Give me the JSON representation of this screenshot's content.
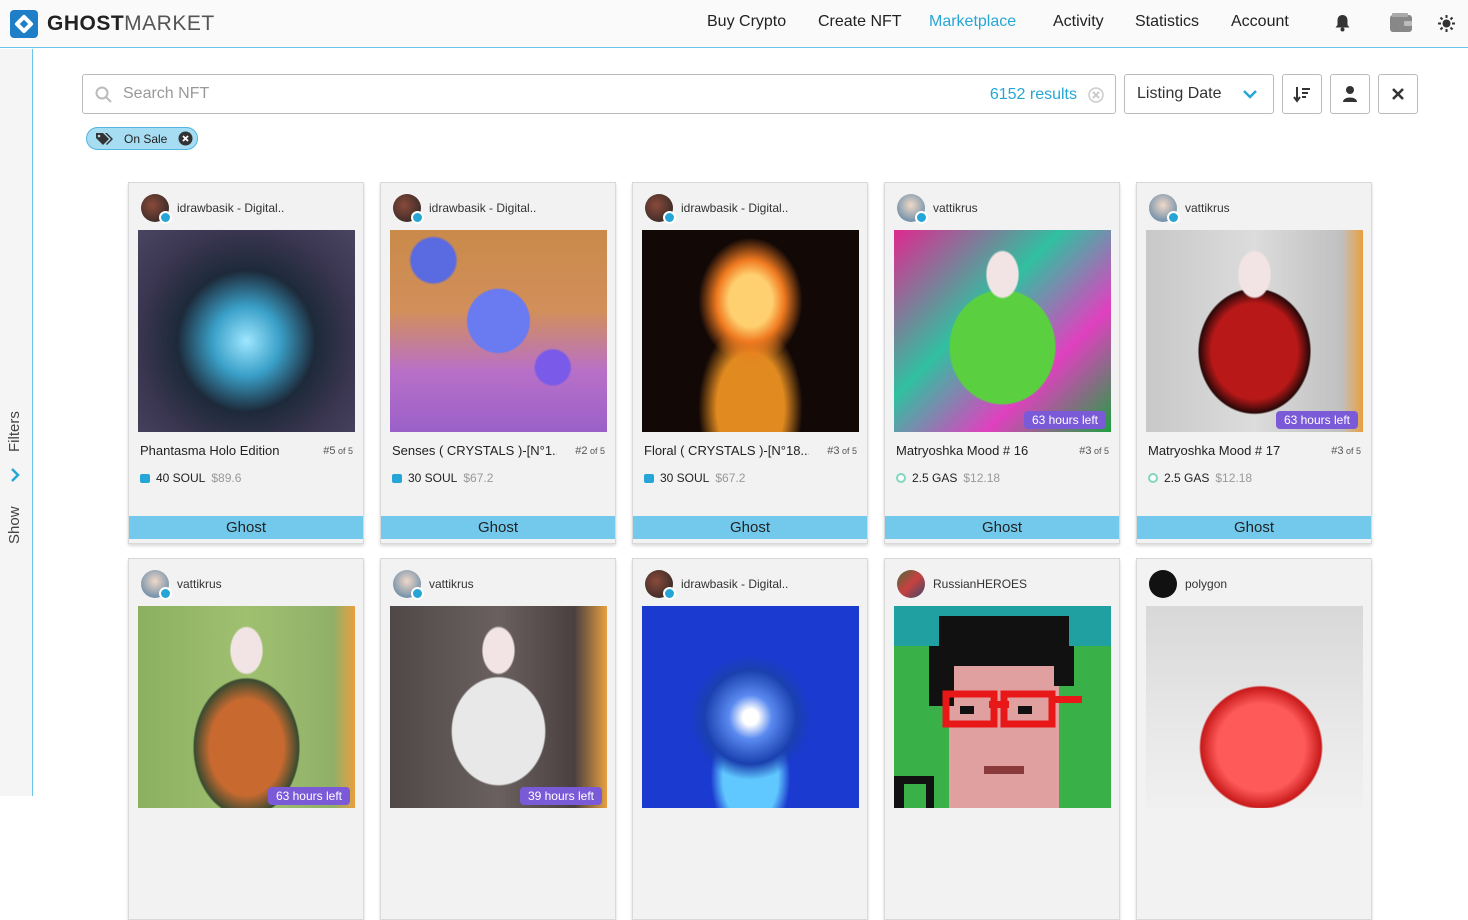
{
  "brand": {
    "name_bold": "GHOST",
    "name_light": "MARKET"
  },
  "nav": [
    "Buy Crypto",
    "Create NFT",
    "Marketplace",
    "Activity",
    "Statistics",
    "Account"
  ],
  "nav_active": "Marketplace",
  "sidebar": {
    "show": "Show",
    "filters": "Filters"
  },
  "search": {
    "placeholder": "Search NFT",
    "value": "",
    "results": "6152 results"
  },
  "sort": {
    "selected": "Listing Date"
  },
  "filter_chip": {
    "label": "On Sale"
  },
  "accent_color": "#26a6d6",
  "cards": [
    {
      "creator": "idrawbasik - Digital..",
      "name": "Phantasma Holo Edition",
      "edition": "#5",
      "of": "of 5",
      "price": "40 SOUL",
      "usd": "$89.6",
      "currency": "SOUL",
      "timer": "",
      "footer": "Ghost"
    },
    {
      "creator": "idrawbasik - Digital..",
      "name": "Senses ( CRYSTALS )-[N°1...",
      "edition": "#2",
      "of": "of 5",
      "price": "30 SOUL",
      "usd": "$67.2",
      "currency": "SOUL",
      "timer": "",
      "footer": "Ghost"
    },
    {
      "creator": "idrawbasik - Digital..",
      "name": "Floral ( CRYSTALS )-[N°18...",
      "edition": "#3",
      "of": "of 5",
      "price": "30 SOUL",
      "usd": "$67.2",
      "currency": "SOUL",
      "timer": "",
      "footer": "Ghost"
    },
    {
      "creator": "vattikrus",
      "name": "Matryoshka Mood # 16",
      "edition": "#3",
      "of": "of 5",
      "price": "2.5 GAS",
      "usd": "$12.18",
      "currency": "GAS",
      "timer": "63 hours left",
      "footer": "Ghost"
    },
    {
      "creator": "vattikrus",
      "name": "Matryoshka Mood # 17",
      "edition": "#3",
      "of": "of 5",
      "price": "2.5 GAS",
      "usd": "$12.18",
      "currency": "GAS",
      "timer": "63 hours left",
      "footer": "Ghost"
    },
    {
      "creator": "vattikrus",
      "timer": "63 hours left"
    },
    {
      "creator": "vattikrus",
      "timer": "39 hours left"
    },
    {
      "creator": "idrawbasik - Digital..",
      "timer": ""
    },
    {
      "creator": "RussianHEROES",
      "timer": ""
    },
    {
      "creator": "polygon",
      "timer": ""
    }
  ]
}
